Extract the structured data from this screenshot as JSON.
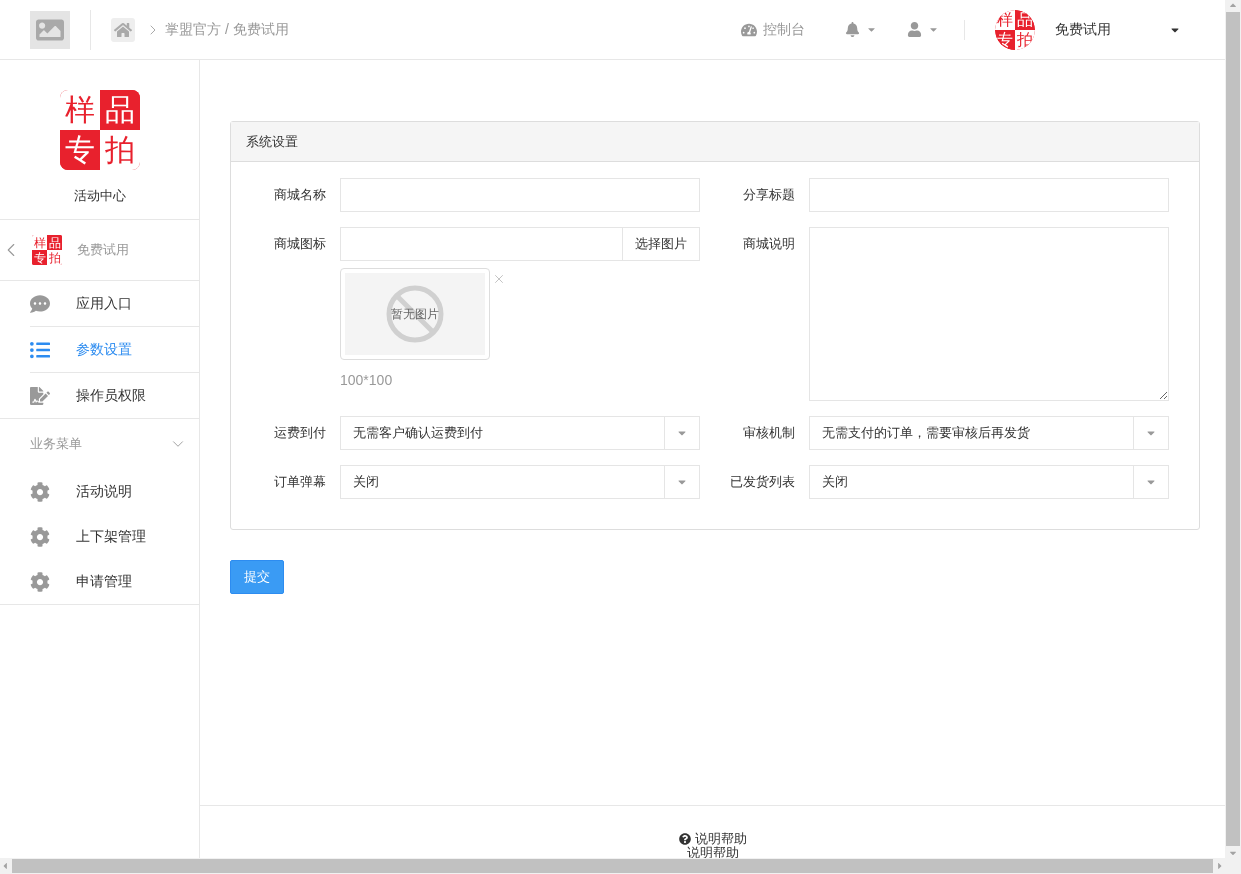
{
  "header": {
    "breadcrumb": "掌盟官方 / 免费试用",
    "console_label": "控制台",
    "account": {
      "logo": [
        "样",
        "品",
        "专",
        "拍"
      ],
      "name": "免费试用"
    }
  },
  "sidebar": {
    "logo": [
      "样",
      "品",
      "专",
      "拍"
    ],
    "title": "活动中心",
    "app": {
      "logo": [
        "样",
        "品",
        "专",
        "拍"
      ],
      "name": "免费试用"
    },
    "items": [
      {
        "label": "应用入口",
        "selected": false
      },
      {
        "label": "参数设置",
        "selected": true
      },
      {
        "label": "操作员权限",
        "selected": false
      }
    ],
    "section": {
      "title": "业务菜单",
      "expanded": true,
      "items": [
        {
          "label": "活动说明",
          "selected": false
        },
        {
          "label": "上下架管理",
          "selected": false
        },
        {
          "label": "申请管理",
          "selected": false
        }
      ]
    }
  },
  "panel": {
    "title": "系统设置",
    "fields": [
      {
        "kind": "text",
        "label": "商城名称"
      },
      {
        "kind": "text",
        "label": "分享标题"
      },
      {
        "kind": "image",
        "label": "商城图标",
        "button": "选择图片",
        "preview": "暂无图片",
        "hint": "100*100"
      },
      {
        "kind": "textarea",
        "label": "商城说明"
      },
      {
        "kind": "select",
        "label": "运费到付",
        "value": "无需客户确认运费到付"
      },
      {
        "kind": "select",
        "label": "审核机制",
        "value": "无需支付的订单，需要审核后再发货"
      },
      {
        "kind": "select",
        "label": "订单弹幕",
        "value": "关闭"
      },
      {
        "kind": "select",
        "label": "已发货列表",
        "value": "关闭"
      }
    ]
  },
  "submit": "提交",
  "footer": {
    "help": "说明帮助",
    "help_repeat": "说明帮助"
  }
}
